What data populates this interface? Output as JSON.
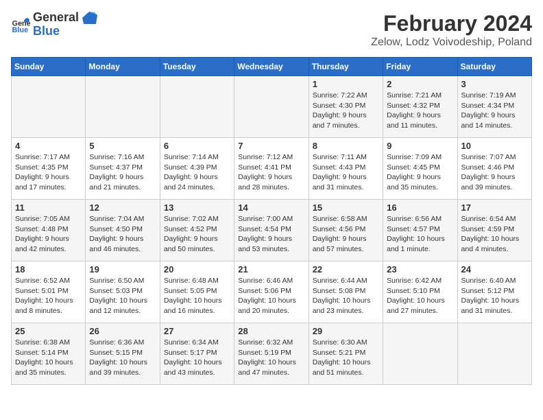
{
  "logo": {
    "text_general": "General",
    "text_blue": "Blue"
  },
  "header": {
    "title": "February 2024",
    "subtitle": "Zelow, Lodz Voivodeship, Poland"
  },
  "weekdays": [
    "Sunday",
    "Monday",
    "Tuesday",
    "Wednesday",
    "Thursday",
    "Friday",
    "Saturday"
  ],
  "weeks": [
    [
      {
        "day": "",
        "info": ""
      },
      {
        "day": "",
        "info": ""
      },
      {
        "day": "",
        "info": ""
      },
      {
        "day": "",
        "info": ""
      },
      {
        "day": "1",
        "info": "Sunrise: 7:22 AM\nSunset: 4:30 PM\nDaylight: 9 hours and 7 minutes."
      },
      {
        "day": "2",
        "info": "Sunrise: 7:21 AM\nSunset: 4:32 PM\nDaylight: 9 hours and 11 minutes."
      },
      {
        "day": "3",
        "info": "Sunrise: 7:19 AM\nSunset: 4:34 PM\nDaylight: 9 hours and 14 minutes."
      }
    ],
    [
      {
        "day": "4",
        "info": "Sunrise: 7:17 AM\nSunset: 4:35 PM\nDaylight: 9 hours and 17 minutes."
      },
      {
        "day": "5",
        "info": "Sunrise: 7:16 AM\nSunset: 4:37 PM\nDaylight: 9 hours and 21 minutes."
      },
      {
        "day": "6",
        "info": "Sunrise: 7:14 AM\nSunset: 4:39 PM\nDaylight: 9 hours and 24 minutes."
      },
      {
        "day": "7",
        "info": "Sunrise: 7:12 AM\nSunset: 4:41 PM\nDaylight: 9 hours and 28 minutes."
      },
      {
        "day": "8",
        "info": "Sunrise: 7:11 AM\nSunset: 4:43 PM\nDaylight: 9 hours and 31 minutes."
      },
      {
        "day": "9",
        "info": "Sunrise: 7:09 AM\nSunset: 4:45 PM\nDaylight: 9 hours and 35 minutes."
      },
      {
        "day": "10",
        "info": "Sunrise: 7:07 AM\nSunset: 4:46 PM\nDaylight: 9 hours and 39 minutes."
      }
    ],
    [
      {
        "day": "11",
        "info": "Sunrise: 7:05 AM\nSunset: 4:48 PM\nDaylight: 9 hours and 42 minutes."
      },
      {
        "day": "12",
        "info": "Sunrise: 7:04 AM\nSunset: 4:50 PM\nDaylight: 9 hours and 46 minutes."
      },
      {
        "day": "13",
        "info": "Sunrise: 7:02 AM\nSunset: 4:52 PM\nDaylight: 9 hours and 50 minutes."
      },
      {
        "day": "14",
        "info": "Sunrise: 7:00 AM\nSunset: 4:54 PM\nDaylight: 9 hours and 53 minutes."
      },
      {
        "day": "15",
        "info": "Sunrise: 6:58 AM\nSunset: 4:56 PM\nDaylight: 9 hours and 57 minutes."
      },
      {
        "day": "16",
        "info": "Sunrise: 6:56 AM\nSunset: 4:57 PM\nDaylight: 10 hours and 1 minute."
      },
      {
        "day": "17",
        "info": "Sunrise: 6:54 AM\nSunset: 4:59 PM\nDaylight: 10 hours and 4 minutes."
      }
    ],
    [
      {
        "day": "18",
        "info": "Sunrise: 6:52 AM\nSunset: 5:01 PM\nDaylight: 10 hours and 8 minutes."
      },
      {
        "day": "19",
        "info": "Sunrise: 6:50 AM\nSunset: 5:03 PM\nDaylight: 10 hours and 12 minutes."
      },
      {
        "day": "20",
        "info": "Sunrise: 6:48 AM\nSunset: 5:05 PM\nDaylight: 10 hours and 16 minutes."
      },
      {
        "day": "21",
        "info": "Sunrise: 6:46 AM\nSunset: 5:06 PM\nDaylight: 10 hours and 20 minutes."
      },
      {
        "day": "22",
        "info": "Sunrise: 6:44 AM\nSunset: 5:08 PM\nDaylight: 10 hours and 23 minutes."
      },
      {
        "day": "23",
        "info": "Sunrise: 6:42 AM\nSunset: 5:10 PM\nDaylight: 10 hours and 27 minutes."
      },
      {
        "day": "24",
        "info": "Sunrise: 6:40 AM\nSunset: 5:12 PM\nDaylight: 10 hours and 31 minutes."
      }
    ],
    [
      {
        "day": "25",
        "info": "Sunrise: 6:38 AM\nSunset: 5:14 PM\nDaylight: 10 hours and 35 minutes."
      },
      {
        "day": "26",
        "info": "Sunrise: 6:36 AM\nSunset: 5:15 PM\nDaylight: 10 hours and 39 minutes."
      },
      {
        "day": "27",
        "info": "Sunrise: 6:34 AM\nSunset: 5:17 PM\nDaylight: 10 hours and 43 minutes."
      },
      {
        "day": "28",
        "info": "Sunrise: 6:32 AM\nSunset: 5:19 PM\nDaylight: 10 hours and 47 minutes."
      },
      {
        "day": "29",
        "info": "Sunrise: 6:30 AM\nSunset: 5:21 PM\nDaylight: 10 hours and 51 minutes."
      },
      {
        "day": "",
        "info": ""
      },
      {
        "day": "",
        "info": ""
      }
    ]
  ]
}
